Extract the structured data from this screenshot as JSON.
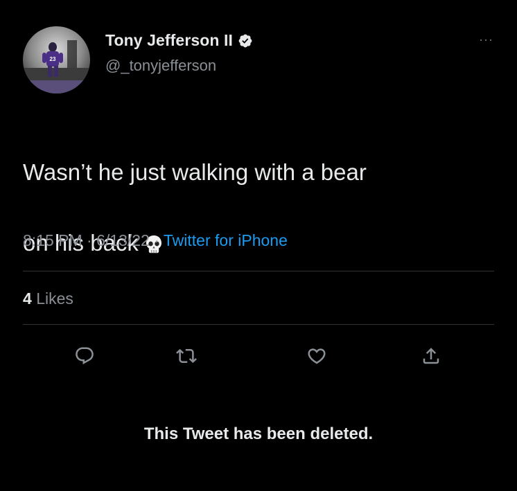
{
  "tweet": {
    "author": {
      "display_name": "Tony Jefferson II",
      "handle": "@_tonyjefferson",
      "verified": true,
      "jersey_number": "23"
    },
    "more_label": "···",
    "text_line1": "Wasn’t he just walking with a bear",
    "text_line2": "on his back",
    "emoji": "skull-emoji",
    "time": "8:15 PM",
    "date": "6/13/22",
    "source": "Twitter for iPhone",
    "separator": " · ",
    "likes_count": "4",
    "likes_label": "Likes"
  },
  "actions": [
    {
      "name": "reply",
      "icon": "reply-icon"
    },
    {
      "name": "retweet",
      "icon": "retweet-icon"
    },
    {
      "name": "like",
      "icon": "heart-icon"
    },
    {
      "name": "share",
      "icon": "share-icon"
    }
  ],
  "notice": {
    "deleted_text": "This Tweet has been deleted."
  },
  "colors": {
    "background": "#000000",
    "text": "#e7e9ea",
    "secondary": "#8b9096",
    "accent": "#1d9bf0",
    "divider": "#2f3336"
  }
}
